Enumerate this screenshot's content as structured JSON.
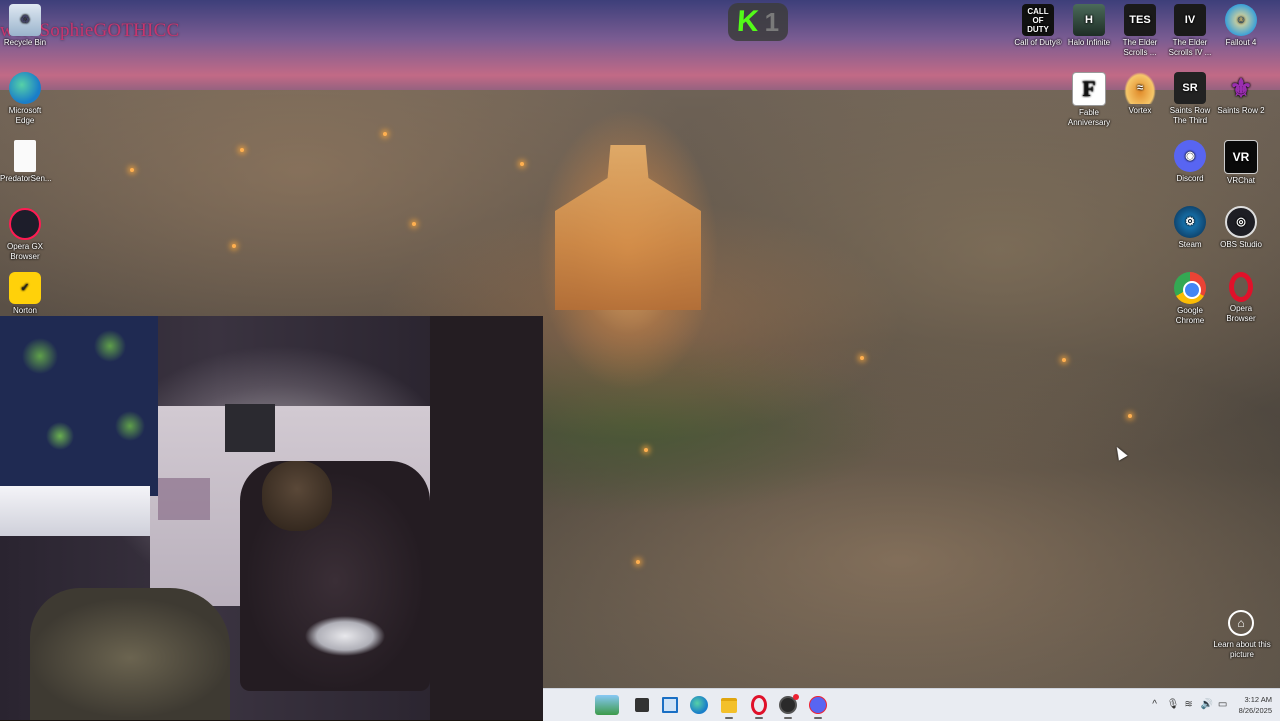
{
  "overlay": {
    "follower_text": "wer: SophieGOTHICC",
    "badge_letter": "K",
    "badge_number": "1"
  },
  "desktop_left": [
    {
      "name": "recycle-bin",
      "label": "Recycle Bin",
      "icon": "recycle-bin-icon"
    },
    {
      "name": "edge",
      "label": "Microsoft Edge",
      "icon": "edge-icon"
    },
    {
      "name": "predatorsense",
      "label": "PredatorSen...",
      "icon": "file-icon"
    },
    {
      "name": "opera-gx",
      "label": "Opera GX Browser",
      "icon": "opera-gx-icon"
    },
    {
      "name": "norton",
      "label": "Norton",
      "icon": "norton-icon"
    }
  ],
  "desktop_right": [
    {
      "name": "call-of-duty",
      "label": "Call of Duty®",
      "icon": "call-of-duty-icon",
      "glyph": "CALL OF DUTY"
    },
    {
      "name": "halo-infinite",
      "label": "Halo Infinite",
      "icon": "halo-icon",
      "glyph": "H"
    },
    {
      "name": "elder-scrolls",
      "label": "The Elder Scrolls ...",
      "icon": "elder-scrolls-icon",
      "glyph": "TES"
    },
    {
      "name": "elder-scrolls-iv",
      "label": "The Elder Scrolls IV ...",
      "icon": "elder-scrolls-iv-icon",
      "glyph": "IV"
    },
    {
      "name": "fallout-4",
      "label": "Fallout 4",
      "icon": "fallout-icon",
      "glyph": "☺"
    },
    {
      "name": "fable-anniversary",
      "label": "Fable Anniversary",
      "icon": "fable-icon",
      "glyph": "F"
    },
    {
      "name": "vortex",
      "label": "Vortex",
      "icon": "vortex-icon",
      "glyph": "≈"
    },
    {
      "name": "saints-row-third",
      "label": "Saints Row The Third",
      "icon": "saints-row-icon",
      "glyph": "SR"
    },
    {
      "name": "saints-row-2",
      "label": "Saints Row 2",
      "icon": "fleur-de-lis-icon",
      "glyph": "⚜"
    },
    {
      "name": "discord",
      "label": "Discord",
      "icon": "discord-icon",
      "glyph": "◉"
    },
    {
      "name": "vrchat",
      "label": "VRChat",
      "icon": "vrchat-icon",
      "glyph": "VR"
    },
    {
      "name": "steam",
      "label": "Steam",
      "icon": "steam-icon",
      "glyph": "⚙"
    },
    {
      "name": "obs-studio",
      "label": "OBS Studio",
      "icon": "obs-icon",
      "glyph": "◎"
    },
    {
      "name": "google-chrome",
      "label": "Google Chrome",
      "icon": "chrome-icon",
      "glyph": ""
    },
    {
      "name": "opera-browser",
      "label": "Opera Browser",
      "icon": "opera-icon",
      "glyph": ""
    }
  ],
  "learn_picture": {
    "label": "Learn about this picture",
    "glyph": "⌂"
  },
  "taskbar": {
    "items": [
      "widgets",
      "task-view",
      "app",
      "edge",
      "file-explorer",
      "opera",
      "obs-studio",
      "discord"
    ],
    "tray": {
      "chevron": "^",
      "mic": "🎙",
      "wifi": "≋",
      "volume": "🔊",
      "battery": "▭"
    },
    "time": "3:12 AM",
    "date": "8/26/2025"
  },
  "colors": {
    "follower_text": "#c8356e",
    "badge_green": "#53fc18",
    "taskbar_bg": "#e9ecf2"
  }
}
